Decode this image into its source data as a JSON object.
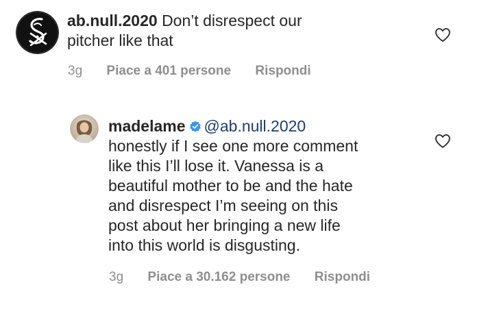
{
  "comments": [
    {
      "username": "ab.null.2020",
      "text_line1": "Don’t disrespect our",
      "text_line2": "pitcher like that",
      "time": "3g",
      "likes": "Piace a 401 persone",
      "reply": "Rispondi",
      "avatar_icon": "white-sox-logo-icon",
      "like_icon": "heart-outline-icon"
    },
    {
      "username": "madelame",
      "verified_icon": "verified-badge-icon",
      "mention": "@ab.null.2020",
      "lines": [
        "honestly if I see one more comment",
        "like this I’ll lose it. Vanessa is a",
        "beautiful mother to be and the hate",
        "and disrespect I’m seeing on this",
        "post about her bringing a new life",
        "into this world is disgusting."
      ],
      "time": "3g",
      "likes": "Piace a 30.162 persone",
      "reply": "Rispondi",
      "avatar_icon": "user-photo-avatar",
      "like_icon": "heart-outline-icon"
    }
  ],
  "colors": {
    "text": "#262626",
    "meta": "#8e8e8e",
    "mention": "#1b3d6d",
    "verified": "#3897f0"
  }
}
